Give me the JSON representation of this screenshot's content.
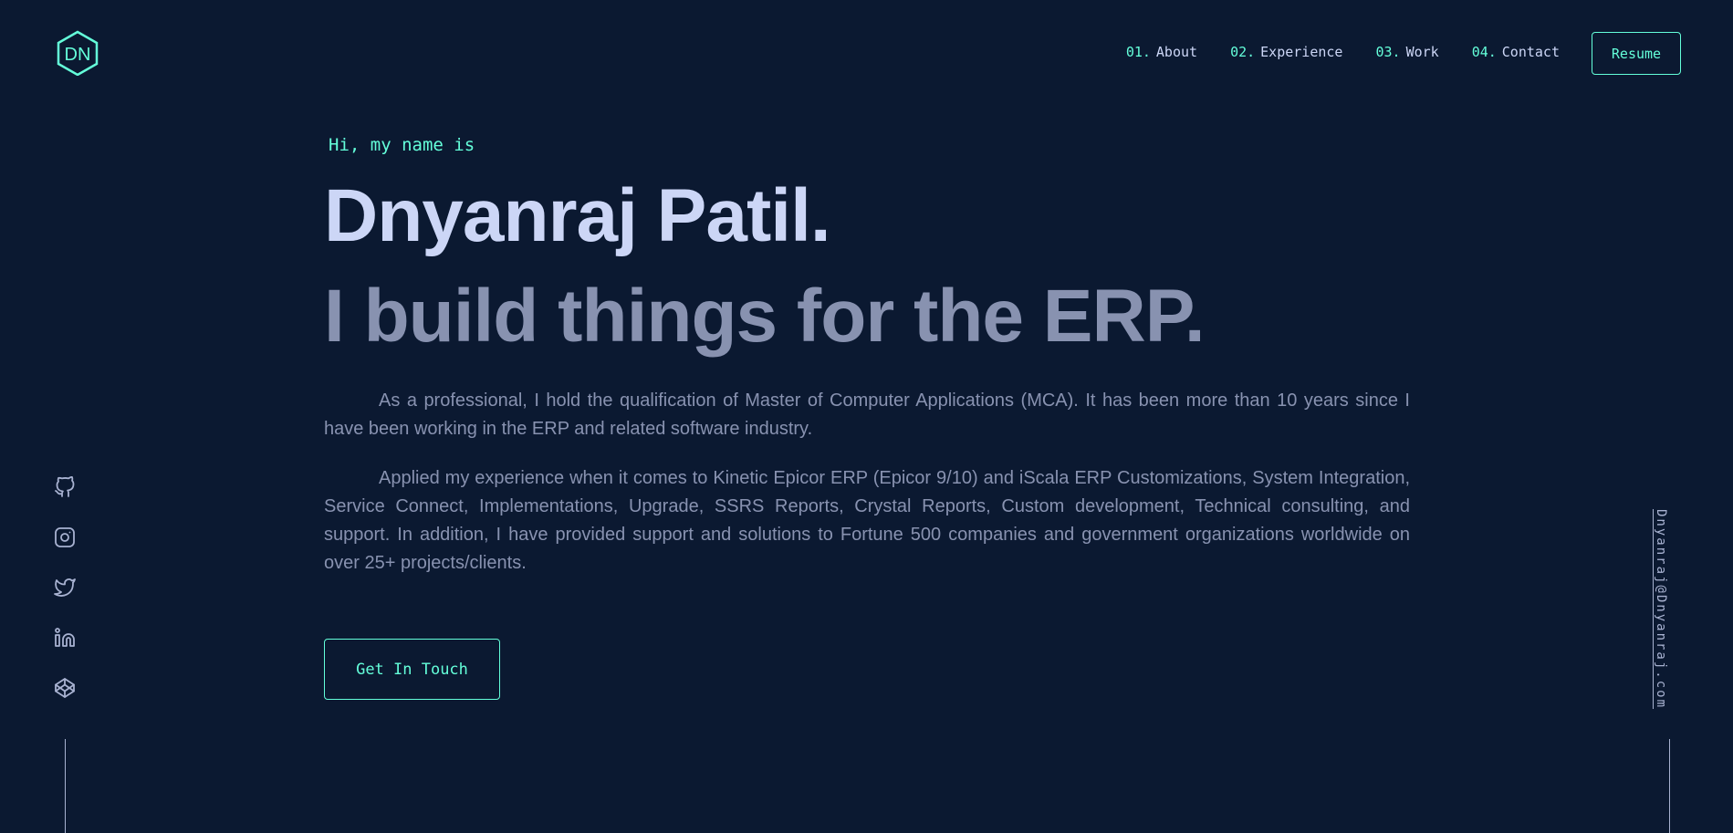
{
  "header": {
    "logo_text": "DN",
    "nav": [
      {
        "num": "01.",
        "label": "About"
      },
      {
        "num": "02.",
        "label": "Experience"
      },
      {
        "num": "03.",
        "label": "Work"
      },
      {
        "num": "04.",
        "label": "Contact"
      }
    ],
    "resume_label": "Resume"
  },
  "hero": {
    "intro": "Hi, my name is",
    "name": "Dnyanraj Patil.",
    "tagline": "I build things for the ERP.",
    "paragraphs": [
      "As a professional, I hold the qualification of Master of Computer Applications (MCA). It has been more than 10 years since I have been working in the ERP and related software industry.",
      "Applied my experience when it comes to Kinetic Epicor ERP (Epicor 9/10) and iScala ERP Customizations, System Integration, Service Connect, Implementations, Upgrade, SSRS Reports, Crystal Reports, Custom development, Technical consulting, and support. In addition, I have provided support and solutions to Fortune 500 companies and government organizations worldwide on over 25+ projects/clients."
    ],
    "cta_label": "Get In Touch"
  },
  "socials": [
    {
      "icon": "github-icon"
    },
    {
      "icon": "instagram-icon"
    },
    {
      "icon": "twitter-icon"
    },
    {
      "icon": "linkedin-icon"
    },
    {
      "icon": "codepen-icon"
    }
  ],
  "email": "Dnyanraj@Dnyanraj.com",
  "colors": {
    "background": "#0b1931",
    "accent": "#64ffda",
    "heading": "#ccd6f6",
    "body": "#8892b0"
  }
}
